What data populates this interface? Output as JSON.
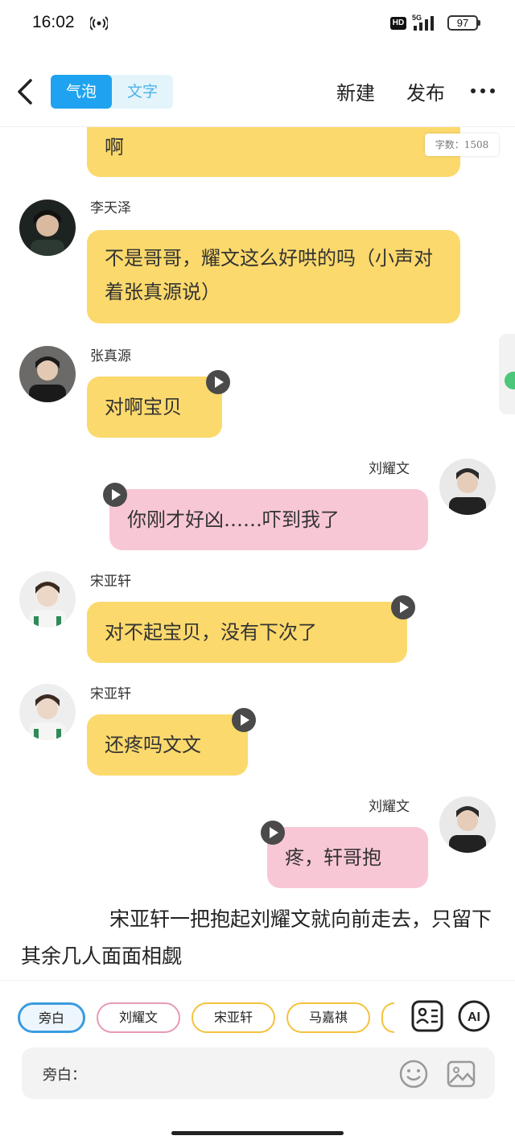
{
  "status_bar": {
    "time": "16:02",
    "hd": "HD",
    "network": "5G",
    "battery": "97"
  },
  "header": {
    "mode_tabs": [
      "气泡",
      "文字"
    ],
    "new_label": "新建",
    "publish_label": "发布"
  },
  "chat": {
    "word_count": "字数：1508",
    "top_bubble_text": "啊",
    "messages": [
      {
        "speaker": "李天泽",
        "text": "不是哥哥，耀文这么好哄的吗（小声对着张真源说）",
        "side": "left",
        "color": "#fbd96c"
      },
      {
        "speaker": "张真源",
        "text": "对啊宝贝",
        "side": "left",
        "color": "#fbd96c",
        "voice": true
      },
      {
        "speaker": "刘耀文",
        "text": "你刚才好凶……吓到我了",
        "side": "right",
        "color": "#f8c7d6",
        "voice": true
      },
      {
        "speaker": "宋亚轩",
        "text": "对不起宝贝，没有下次了",
        "side": "left",
        "color": "#fbd96c",
        "voice": true
      },
      {
        "speaker": "宋亚轩",
        "text": "还疼吗文文",
        "side": "left",
        "color": "#fbd96c",
        "voice": true
      },
      {
        "speaker": "刘耀文",
        "text": "疼，轩哥抱",
        "side": "right",
        "color": "#f8c7d6",
        "voice": true
      }
    ],
    "narration": "宋亚轩一把抱起刘耀文就向前走去，只留下其余几人面面相觑"
  },
  "bottom": {
    "chips": [
      "旁白",
      "刘耀文",
      "宋亚轩",
      "马嘉祺"
    ],
    "ai_label": "AI",
    "input_label": "旁白：",
    "input_value": ""
  }
}
